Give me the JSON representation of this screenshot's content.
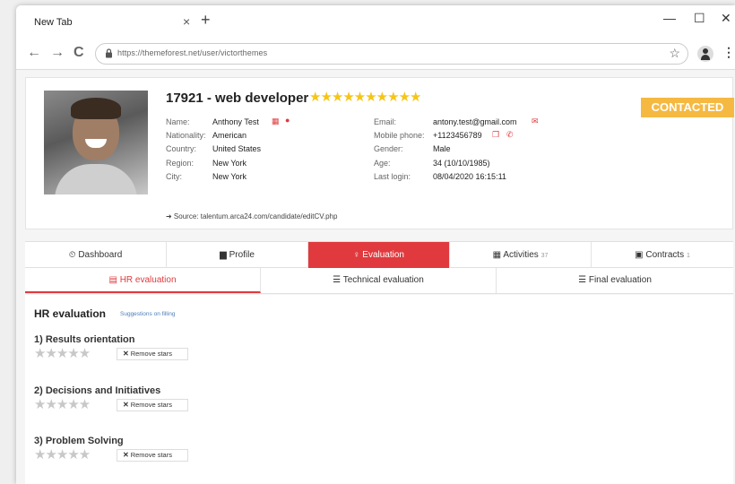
{
  "browser": {
    "tab_title": "New Tab",
    "tab_close": "×",
    "new_tab": "+",
    "minimize": "—",
    "maximize": "☐",
    "close": "✕",
    "back": "←",
    "forward": "→",
    "reload": "C",
    "url": "https://themeforest.net/user/victorthemes",
    "bookmark": "☆",
    "menu": "⋮"
  },
  "candidate": {
    "title": "17921 - web developer",
    "stars": "★★★★★★★★★★",
    "status": "CONTACTED",
    "left_fields": [
      {
        "label": "Name:",
        "value": "Anthony Test"
      },
      {
        "label": "Nationality:",
        "value": "American"
      },
      {
        "label": "Country:",
        "value": "United States"
      },
      {
        "label": "Region:",
        "value": "New York"
      },
      {
        "label": "City:",
        "value": "New York"
      }
    ],
    "right_fields": [
      {
        "label": "Email:",
        "value": "antony.test@gmail.com"
      },
      {
        "label": "Mobile phone:",
        "value": "+1123456789"
      },
      {
        "label": "Gender:",
        "value": "Male"
      },
      {
        "label": "Age:",
        "value": "34 (10/10/1985)"
      },
      {
        "label": "Last login:",
        "value": "08/04/2020 16:15:11"
      }
    ],
    "source": "➜ Source: talentum.arca24.com/candidate/editCV.php"
  },
  "main_tabs": [
    {
      "icon": "⏲",
      "label": "Dashboard",
      "count": ""
    },
    {
      "icon": "▆",
      "label": "Profile",
      "count": ""
    },
    {
      "icon": "♀",
      "label": "Evaluation",
      "count": ""
    },
    {
      "icon": "▦",
      "label": "Activities",
      "count": "37"
    },
    {
      "icon": "▣",
      "label": "Contracts",
      "count": "1"
    }
  ],
  "sub_tabs": [
    {
      "icon": "▤",
      "label": "HR evaluation"
    },
    {
      "icon": "☰",
      "label": "Technical evaluation"
    },
    {
      "icon": "☰",
      "label": "Final evaluation"
    }
  ],
  "panel": {
    "title": "HR evaluation",
    "link": "Suggestions on filling",
    "criteria": [
      {
        "title": "1) Results orientation",
        "stars": "★★★★★",
        "remove": "Remove stars"
      },
      {
        "title": "2) Decisions and Initiatives",
        "stars": "★★★★★",
        "remove": "Remove stars"
      },
      {
        "title": "3) Problem Solving",
        "stars": "★★★★★",
        "remove": "Remove stars"
      }
    ],
    "remove_glyph": "✕"
  },
  "colors": {
    "accent": "#e03a3e",
    "status": "#f5b942",
    "stars": "#f5c518"
  }
}
